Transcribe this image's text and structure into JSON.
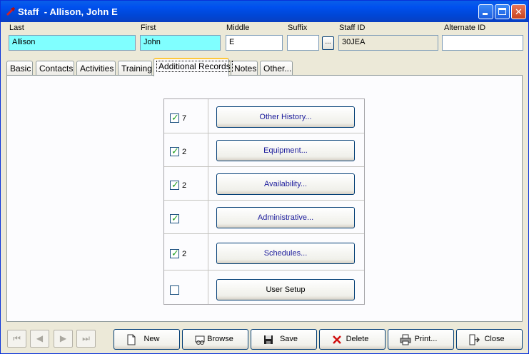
{
  "window": {
    "title": "Staff  - Allison, John E",
    "icon": "app-icon",
    "controls": {
      "minimize": "minimize-icon",
      "maximize": "maximize-icon",
      "close": "✕"
    }
  },
  "header": {
    "last_label": "Last",
    "last_value": "Allison",
    "first_label": "First",
    "first_value": "John",
    "middle_label": "Middle",
    "middle_value": "E",
    "suffix_label": "Suffix",
    "suffix_value": "",
    "suffix_button": "...",
    "staffid_label": "Staff ID",
    "staffid_value": "30JEA",
    "altid_label": "Alternate ID",
    "altid_value": ""
  },
  "tabs": [
    {
      "label": "Basic",
      "active": false
    },
    {
      "label": "Contacts",
      "active": false
    },
    {
      "label": "Activities",
      "active": false
    },
    {
      "label": "Training",
      "active": false
    },
    {
      "label": "Additional Records",
      "active": true
    },
    {
      "label": "Notes",
      "active": false
    },
    {
      "label": "Other...",
      "active": false
    }
  ],
  "records": [
    {
      "checked": true,
      "count": "7",
      "button": "Other History..."
    },
    {
      "checked": true,
      "count": "2",
      "button": "Equipment..."
    },
    {
      "checked": true,
      "count": "2",
      "button": "Availability..."
    },
    {
      "checked": true,
      "count": "",
      "button": "Administrative..."
    },
    {
      "checked": true,
      "count": "2",
      "button": "Schedules..."
    },
    {
      "checked": false,
      "count": "",
      "button": "User Setup"
    }
  ],
  "navigation": {
    "first": "⏮",
    "prev": "◀",
    "next": "▶",
    "last": "⏭"
  },
  "footer": {
    "new": "New",
    "browse": "Browse",
    "save": "Save",
    "delete": "Delete",
    "print": "Print...",
    "close": "Close"
  },
  "colors": {
    "titlebar": "#0050ee",
    "highlight_field": "#80ffff",
    "link_text": "#1c1c9c"
  }
}
